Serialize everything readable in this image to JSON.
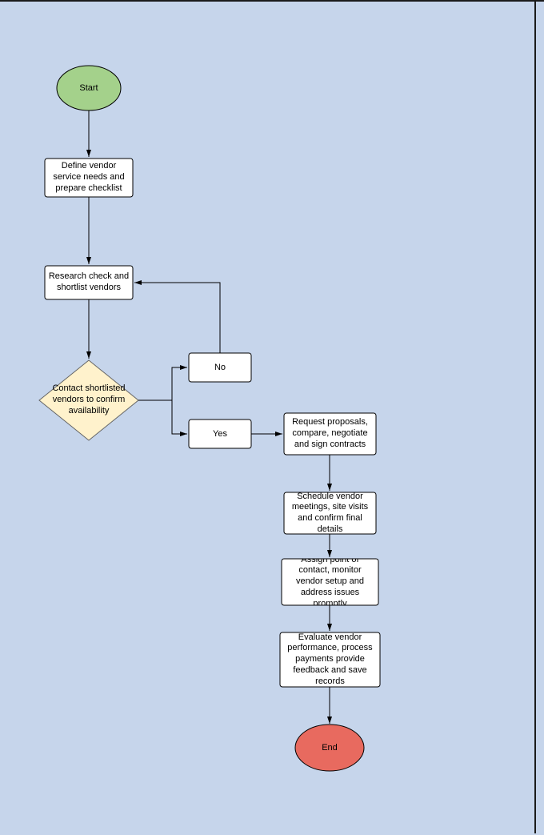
{
  "chart_data": {
    "type": "flowchart",
    "nodes": [
      {
        "id": "start",
        "shape": "ellipse",
        "label": "Start",
        "fill": "#a4d18b"
      },
      {
        "id": "define",
        "shape": "rect",
        "label": "Define vendor service needs and prepare checklist"
      },
      {
        "id": "research",
        "shape": "rect",
        "label": "Research check and shortlist vendors"
      },
      {
        "id": "contact",
        "shape": "diamond",
        "label": "Contact shortlisted vendors to confirm availability"
      },
      {
        "id": "no",
        "shape": "rect",
        "label": "No"
      },
      {
        "id": "yes",
        "shape": "rect",
        "label": "Yes"
      },
      {
        "id": "request",
        "shape": "rect",
        "label": "Request proposals, compare, negotiate and sign contracts"
      },
      {
        "id": "schedule",
        "shape": "rect",
        "label": "Schedule vendor meetings, site visits and confirm final details"
      },
      {
        "id": "assign",
        "shape": "rect",
        "label": "Assign point of contact, monitor vendor setup and address issues promptly"
      },
      {
        "id": "evaluate",
        "shape": "rect",
        "label": "Evaluate vendor performance, process payments provide feedback and save records"
      },
      {
        "id": "end",
        "shape": "ellipse",
        "label": "End",
        "fill": "#e86a5f"
      }
    ],
    "edges": [
      {
        "from": "start",
        "to": "define"
      },
      {
        "from": "define",
        "to": "research"
      },
      {
        "from": "research",
        "to": "contact"
      },
      {
        "from": "contact",
        "to": "no"
      },
      {
        "from": "contact",
        "to": "yes"
      },
      {
        "from": "no",
        "to": "research"
      },
      {
        "from": "yes",
        "to": "request"
      },
      {
        "from": "request",
        "to": "schedule"
      },
      {
        "from": "schedule",
        "to": "assign"
      },
      {
        "from": "assign",
        "to": "evaluate"
      },
      {
        "from": "evaluate",
        "to": "end"
      }
    ]
  }
}
